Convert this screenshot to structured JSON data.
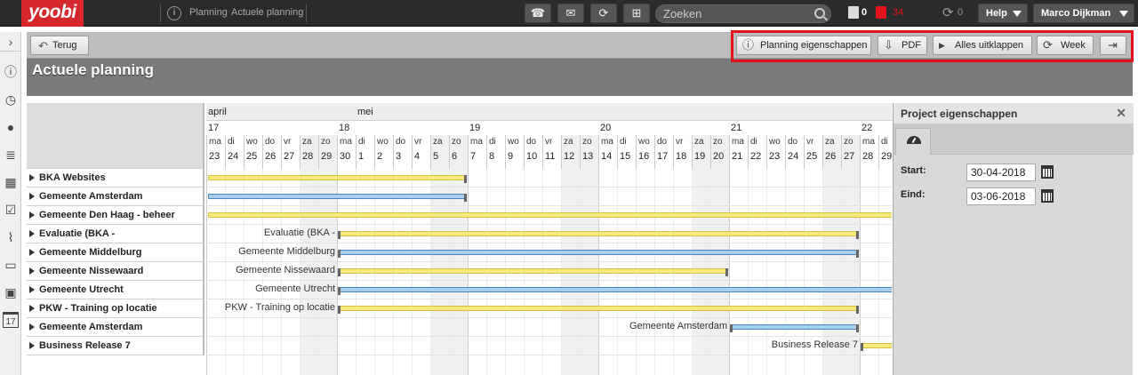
{
  "app": {
    "logo": "yoobi"
  },
  "breadcrumb": [
    "Planning",
    "Actuele planning"
  ],
  "search": {
    "placeholder": "Zoeken"
  },
  "counters": {
    "tasks": "0",
    "alerts": "34",
    "sync": "0"
  },
  "help_label": "Help",
  "user_name": "Marco Dijkman",
  "colors": {
    "brand": "#d6272d",
    "alert": "#e2131c",
    "bar_yellow": "#f7ea7c",
    "bar_blue": "#a8d0ee",
    "highlight_box": "#e2131c"
  },
  "toolbar": {
    "back_label": "Terug",
    "properties_label": "Planning eigenschappen",
    "pdf_label": "PDF",
    "expand_label": "Alles uitklappen",
    "week_label": "Week"
  },
  "page_title": "Actuele planning",
  "timeline": {
    "months": [
      {
        "label": "april",
        "start_index": 0
      },
      {
        "label": "mei",
        "start_index": 8
      }
    ],
    "weeks": [
      {
        "label": "17",
        "start_index": 0
      },
      {
        "label": "18",
        "start_index": 7
      },
      {
        "label": "19",
        "start_index": 14
      },
      {
        "label": "20",
        "start_index": 21
      },
      {
        "label": "21",
        "start_index": 28
      },
      {
        "label": "22",
        "start_index": 35
      }
    ],
    "days": [
      {
        "dn": "ma",
        "dd": "23"
      },
      {
        "dn": "di",
        "dd": "24"
      },
      {
        "dn": "wo",
        "dd": "25"
      },
      {
        "dn": "do",
        "dd": "26"
      },
      {
        "dn": "vr",
        "dd": "27"
      },
      {
        "dn": "za",
        "dd": "28"
      },
      {
        "dn": "zo",
        "dd": "29"
      },
      {
        "dn": "ma",
        "dd": "30"
      },
      {
        "dn": "di",
        "dd": "1"
      },
      {
        "dn": "wo",
        "dd": "2"
      },
      {
        "dn": "do",
        "dd": "3"
      },
      {
        "dn": "vr",
        "dd": "4"
      },
      {
        "dn": "za",
        "dd": "5"
      },
      {
        "dn": "zo",
        "dd": "6"
      },
      {
        "dn": "ma",
        "dd": "7"
      },
      {
        "dn": "di",
        "dd": "8"
      },
      {
        "dn": "wo",
        "dd": "9"
      },
      {
        "dn": "do",
        "dd": "10"
      },
      {
        "dn": "vr",
        "dd": "11"
      },
      {
        "dn": "za",
        "dd": "12"
      },
      {
        "dn": "zo",
        "dd": "13"
      },
      {
        "dn": "ma",
        "dd": "14"
      },
      {
        "dn": "di",
        "dd": "15"
      },
      {
        "dn": "wo",
        "dd": "16"
      },
      {
        "dn": "do",
        "dd": "17"
      },
      {
        "dn": "vr",
        "dd": "18"
      },
      {
        "dn": "za",
        "dd": "19"
      },
      {
        "dn": "zo",
        "dd": "20"
      },
      {
        "dn": "ma",
        "dd": "21"
      },
      {
        "dn": "di",
        "dd": "22"
      },
      {
        "dn": "wo",
        "dd": "23"
      },
      {
        "dn": "do",
        "dd": "24"
      },
      {
        "dn": "vr",
        "dd": "25"
      },
      {
        "dn": "za",
        "dd": "26"
      },
      {
        "dn": "zo",
        "dd": "27"
      },
      {
        "dn": "ma",
        "dd": "28"
      },
      {
        "dn": "di",
        "dd": "29"
      }
    ]
  },
  "rows": [
    {
      "name": "BKA Websites",
      "bar": {
        "start": 0,
        "end": 14,
        "color": "yellow"
      },
      "label": ""
    },
    {
      "name": "Gemeente Amsterdam",
      "bar": {
        "start": 0,
        "end": 14,
        "color": "blue"
      },
      "label": ""
    },
    {
      "name": "Gemeente Den Haag - beheer",
      "bar": {
        "start": 0,
        "end": 37,
        "color": "yellow"
      },
      "label": ""
    },
    {
      "name": "Evaluatie (BKA -",
      "bar": {
        "start": 7,
        "end": 35,
        "color": "yellow"
      },
      "label": "Evaluatie (BKA -"
    },
    {
      "name": "Gemeente Middelburg",
      "bar": {
        "start": 7,
        "end": 35,
        "color": "blue"
      },
      "label": "Gemeente Middelburg"
    },
    {
      "name": "Gemeente Nissewaard",
      "bar": {
        "start": 7,
        "end": 28,
        "color": "yellow"
      },
      "label": "Gemeente Nissewaard"
    },
    {
      "name": "Gemeente Utrecht",
      "bar": {
        "start": 7,
        "end": 37,
        "color": "blue"
      },
      "label": "Gemeente Utrecht"
    },
    {
      "name": "PKW - Training op locatie",
      "bar": {
        "start": 7,
        "end": 35,
        "color": "yellow"
      },
      "label": "PKW - Training op locatie"
    },
    {
      "name": "Gemeente Amsterdam",
      "bar": {
        "start": 28,
        "end": 35,
        "color": "blue"
      },
      "label": "Gemeente Amsterdam"
    },
    {
      "name": "Business Release 7",
      "bar": {
        "start": 35,
        "end": 37,
        "color": "yellow"
      },
      "label": "Business Release 7"
    }
  ],
  "panel": {
    "title": "Project eigenschappen",
    "start_label": "Start:",
    "start_value": "30-04-2018",
    "end_label": "Eind:",
    "end_value": "03-06-2018"
  }
}
